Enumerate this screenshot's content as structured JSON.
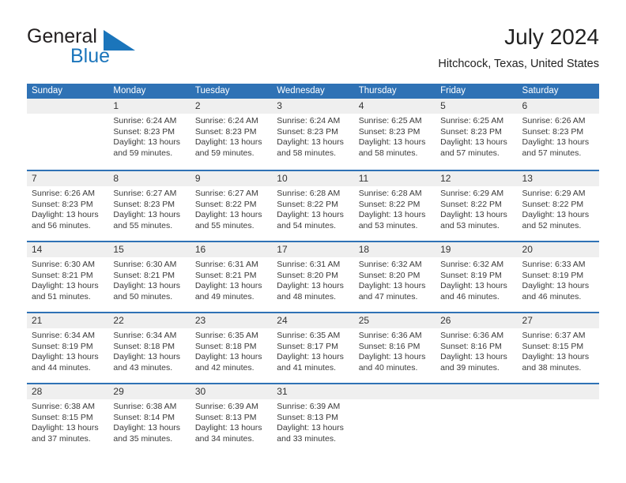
{
  "brand": {
    "name_part1": "General",
    "name_part2": "Blue",
    "accent_color": "#1b75bb"
  },
  "header": {
    "title": "July 2024",
    "location": "Hitchcock, Texas, United States"
  },
  "theme": {
    "header_row_color": "#2f72b5",
    "row_shade_color": "#efefef",
    "text_color": "#3a3a3a"
  },
  "weekdays": [
    "Sunday",
    "Monday",
    "Tuesday",
    "Wednesday",
    "Thursday",
    "Friday",
    "Saturday"
  ],
  "weeks": [
    [
      {
        "empty": true
      },
      {
        "day": "1",
        "lines": [
          "Sunrise: 6:24 AM",
          "Sunset: 8:23 PM",
          "Daylight: 13 hours",
          "and 59 minutes."
        ]
      },
      {
        "day": "2",
        "lines": [
          "Sunrise: 6:24 AM",
          "Sunset: 8:23 PM",
          "Daylight: 13 hours",
          "and 59 minutes."
        ]
      },
      {
        "day": "3",
        "lines": [
          "Sunrise: 6:24 AM",
          "Sunset: 8:23 PM",
          "Daylight: 13 hours",
          "and 58 minutes."
        ]
      },
      {
        "day": "4",
        "lines": [
          "Sunrise: 6:25 AM",
          "Sunset: 8:23 PM",
          "Daylight: 13 hours",
          "and 58 minutes."
        ]
      },
      {
        "day": "5",
        "lines": [
          "Sunrise: 6:25 AM",
          "Sunset: 8:23 PM",
          "Daylight: 13 hours",
          "and 57 minutes."
        ]
      },
      {
        "day": "6",
        "lines": [
          "Sunrise: 6:26 AM",
          "Sunset: 8:23 PM",
          "Daylight: 13 hours",
          "and 57 minutes."
        ]
      }
    ],
    [
      {
        "day": "7",
        "lines": [
          "Sunrise: 6:26 AM",
          "Sunset: 8:23 PM",
          "Daylight: 13 hours",
          "and 56 minutes."
        ]
      },
      {
        "day": "8",
        "lines": [
          "Sunrise: 6:27 AM",
          "Sunset: 8:23 PM",
          "Daylight: 13 hours",
          "and 55 minutes."
        ]
      },
      {
        "day": "9",
        "lines": [
          "Sunrise: 6:27 AM",
          "Sunset: 8:22 PM",
          "Daylight: 13 hours",
          "and 55 minutes."
        ]
      },
      {
        "day": "10",
        "lines": [
          "Sunrise: 6:28 AM",
          "Sunset: 8:22 PM",
          "Daylight: 13 hours",
          "and 54 minutes."
        ]
      },
      {
        "day": "11",
        "lines": [
          "Sunrise: 6:28 AM",
          "Sunset: 8:22 PM",
          "Daylight: 13 hours",
          "and 53 minutes."
        ]
      },
      {
        "day": "12",
        "lines": [
          "Sunrise: 6:29 AM",
          "Sunset: 8:22 PM",
          "Daylight: 13 hours",
          "and 53 minutes."
        ]
      },
      {
        "day": "13",
        "lines": [
          "Sunrise: 6:29 AM",
          "Sunset: 8:22 PM",
          "Daylight: 13 hours",
          "and 52 minutes."
        ]
      }
    ],
    [
      {
        "day": "14",
        "lines": [
          "Sunrise: 6:30 AM",
          "Sunset: 8:21 PM",
          "Daylight: 13 hours",
          "and 51 minutes."
        ]
      },
      {
        "day": "15",
        "lines": [
          "Sunrise: 6:30 AM",
          "Sunset: 8:21 PM",
          "Daylight: 13 hours",
          "and 50 minutes."
        ]
      },
      {
        "day": "16",
        "lines": [
          "Sunrise: 6:31 AM",
          "Sunset: 8:21 PM",
          "Daylight: 13 hours",
          "and 49 minutes."
        ]
      },
      {
        "day": "17",
        "lines": [
          "Sunrise: 6:31 AM",
          "Sunset: 8:20 PM",
          "Daylight: 13 hours",
          "and 48 minutes."
        ]
      },
      {
        "day": "18",
        "lines": [
          "Sunrise: 6:32 AM",
          "Sunset: 8:20 PM",
          "Daylight: 13 hours",
          "and 47 minutes."
        ]
      },
      {
        "day": "19",
        "lines": [
          "Sunrise: 6:32 AM",
          "Sunset: 8:19 PM",
          "Daylight: 13 hours",
          "and 46 minutes."
        ]
      },
      {
        "day": "20",
        "lines": [
          "Sunrise: 6:33 AM",
          "Sunset: 8:19 PM",
          "Daylight: 13 hours",
          "and 46 minutes."
        ]
      }
    ],
    [
      {
        "day": "21",
        "lines": [
          "Sunrise: 6:34 AM",
          "Sunset: 8:19 PM",
          "Daylight: 13 hours",
          "and 44 minutes."
        ]
      },
      {
        "day": "22",
        "lines": [
          "Sunrise: 6:34 AM",
          "Sunset: 8:18 PM",
          "Daylight: 13 hours",
          "and 43 minutes."
        ]
      },
      {
        "day": "23",
        "lines": [
          "Sunrise: 6:35 AM",
          "Sunset: 8:18 PM",
          "Daylight: 13 hours",
          "and 42 minutes."
        ]
      },
      {
        "day": "24",
        "lines": [
          "Sunrise: 6:35 AM",
          "Sunset: 8:17 PM",
          "Daylight: 13 hours",
          "and 41 minutes."
        ]
      },
      {
        "day": "25",
        "lines": [
          "Sunrise: 6:36 AM",
          "Sunset: 8:16 PM",
          "Daylight: 13 hours",
          "and 40 minutes."
        ]
      },
      {
        "day": "26",
        "lines": [
          "Sunrise: 6:36 AM",
          "Sunset: 8:16 PM",
          "Daylight: 13 hours",
          "and 39 minutes."
        ]
      },
      {
        "day": "27",
        "lines": [
          "Sunrise: 6:37 AM",
          "Sunset: 8:15 PM",
          "Daylight: 13 hours",
          "and 38 minutes."
        ]
      }
    ],
    [
      {
        "day": "28",
        "lines": [
          "Sunrise: 6:38 AM",
          "Sunset: 8:15 PM",
          "Daylight: 13 hours",
          "and 37 minutes."
        ]
      },
      {
        "day": "29",
        "lines": [
          "Sunrise: 6:38 AM",
          "Sunset: 8:14 PM",
          "Daylight: 13 hours",
          "and 35 minutes."
        ]
      },
      {
        "day": "30",
        "lines": [
          "Sunrise: 6:39 AM",
          "Sunset: 8:13 PM",
          "Daylight: 13 hours",
          "and 34 minutes."
        ]
      },
      {
        "day": "31",
        "lines": [
          "Sunrise: 6:39 AM",
          "Sunset: 8:13 PM",
          "Daylight: 13 hours",
          "and 33 minutes."
        ]
      },
      {
        "empty": true
      },
      {
        "empty": true
      },
      {
        "empty": true
      }
    ]
  ]
}
